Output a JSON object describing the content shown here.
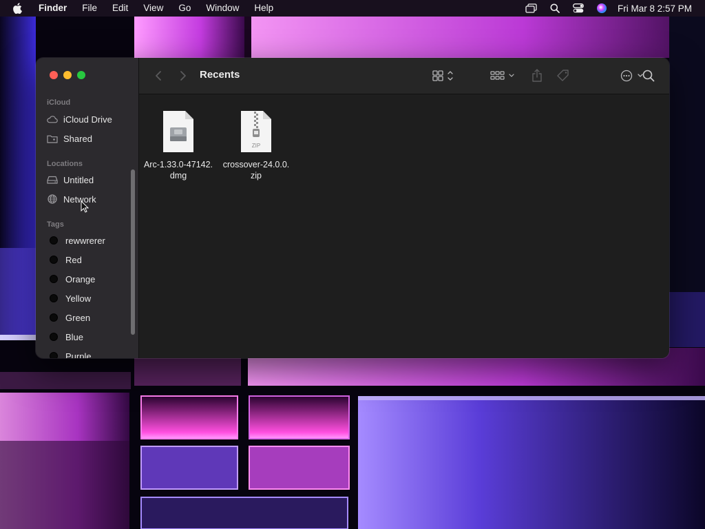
{
  "menubar": {
    "app_name": "Finder",
    "menus": [
      "File",
      "Edit",
      "View",
      "Go",
      "Window",
      "Help"
    ],
    "clock": "Fri Mar 8  2:57 PM",
    "status_icons": [
      "screen-mirroring-icon",
      "spotlight-search-icon",
      "control-center-icon",
      "siri-icon"
    ]
  },
  "window": {
    "title": "Recents",
    "sidebar": {
      "sections": [
        {
          "label": "iCloud",
          "items": [
            {
              "label": "iCloud Drive",
              "icon": "cloud-icon"
            },
            {
              "label": "Shared",
              "icon": "shared-folder-icon"
            }
          ]
        },
        {
          "label": "Locations",
          "items": [
            {
              "label": "Untitled",
              "icon": "disk-icon"
            },
            {
              "label": "Network",
              "icon": "network-globe-icon"
            }
          ]
        },
        {
          "label": "Tags",
          "items": [
            {
              "label": "rewwrerer"
            },
            {
              "label": "Red"
            },
            {
              "label": "Orange"
            },
            {
              "label": "Yellow"
            },
            {
              "label": "Green"
            },
            {
              "label": "Blue"
            },
            {
              "label": "Purple"
            }
          ]
        }
      ]
    },
    "files": [
      {
        "name": "Arc-1.33.0-47142.dmg",
        "line1": "Arc-1.33.0-47142.",
        "line2": "dmg",
        "type": "disk-image"
      },
      {
        "name": "crossover-24.0.0.zip",
        "line1": "crossover-24.0.0.",
        "line2": "zip",
        "type": "zip-archive",
        "badge": "ZIP"
      }
    ]
  },
  "colors": {
    "close": "#ff5f57",
    "minimize": "#febc2e",
    "zoom": "#28c840",
    "sidebar_bg": "#2c2a2e",
    "content_bg": "#1e1e1e",
    "toolbar_bg": "#262626",
    "accent_wallpaper": "#d23cff"
  }
}
